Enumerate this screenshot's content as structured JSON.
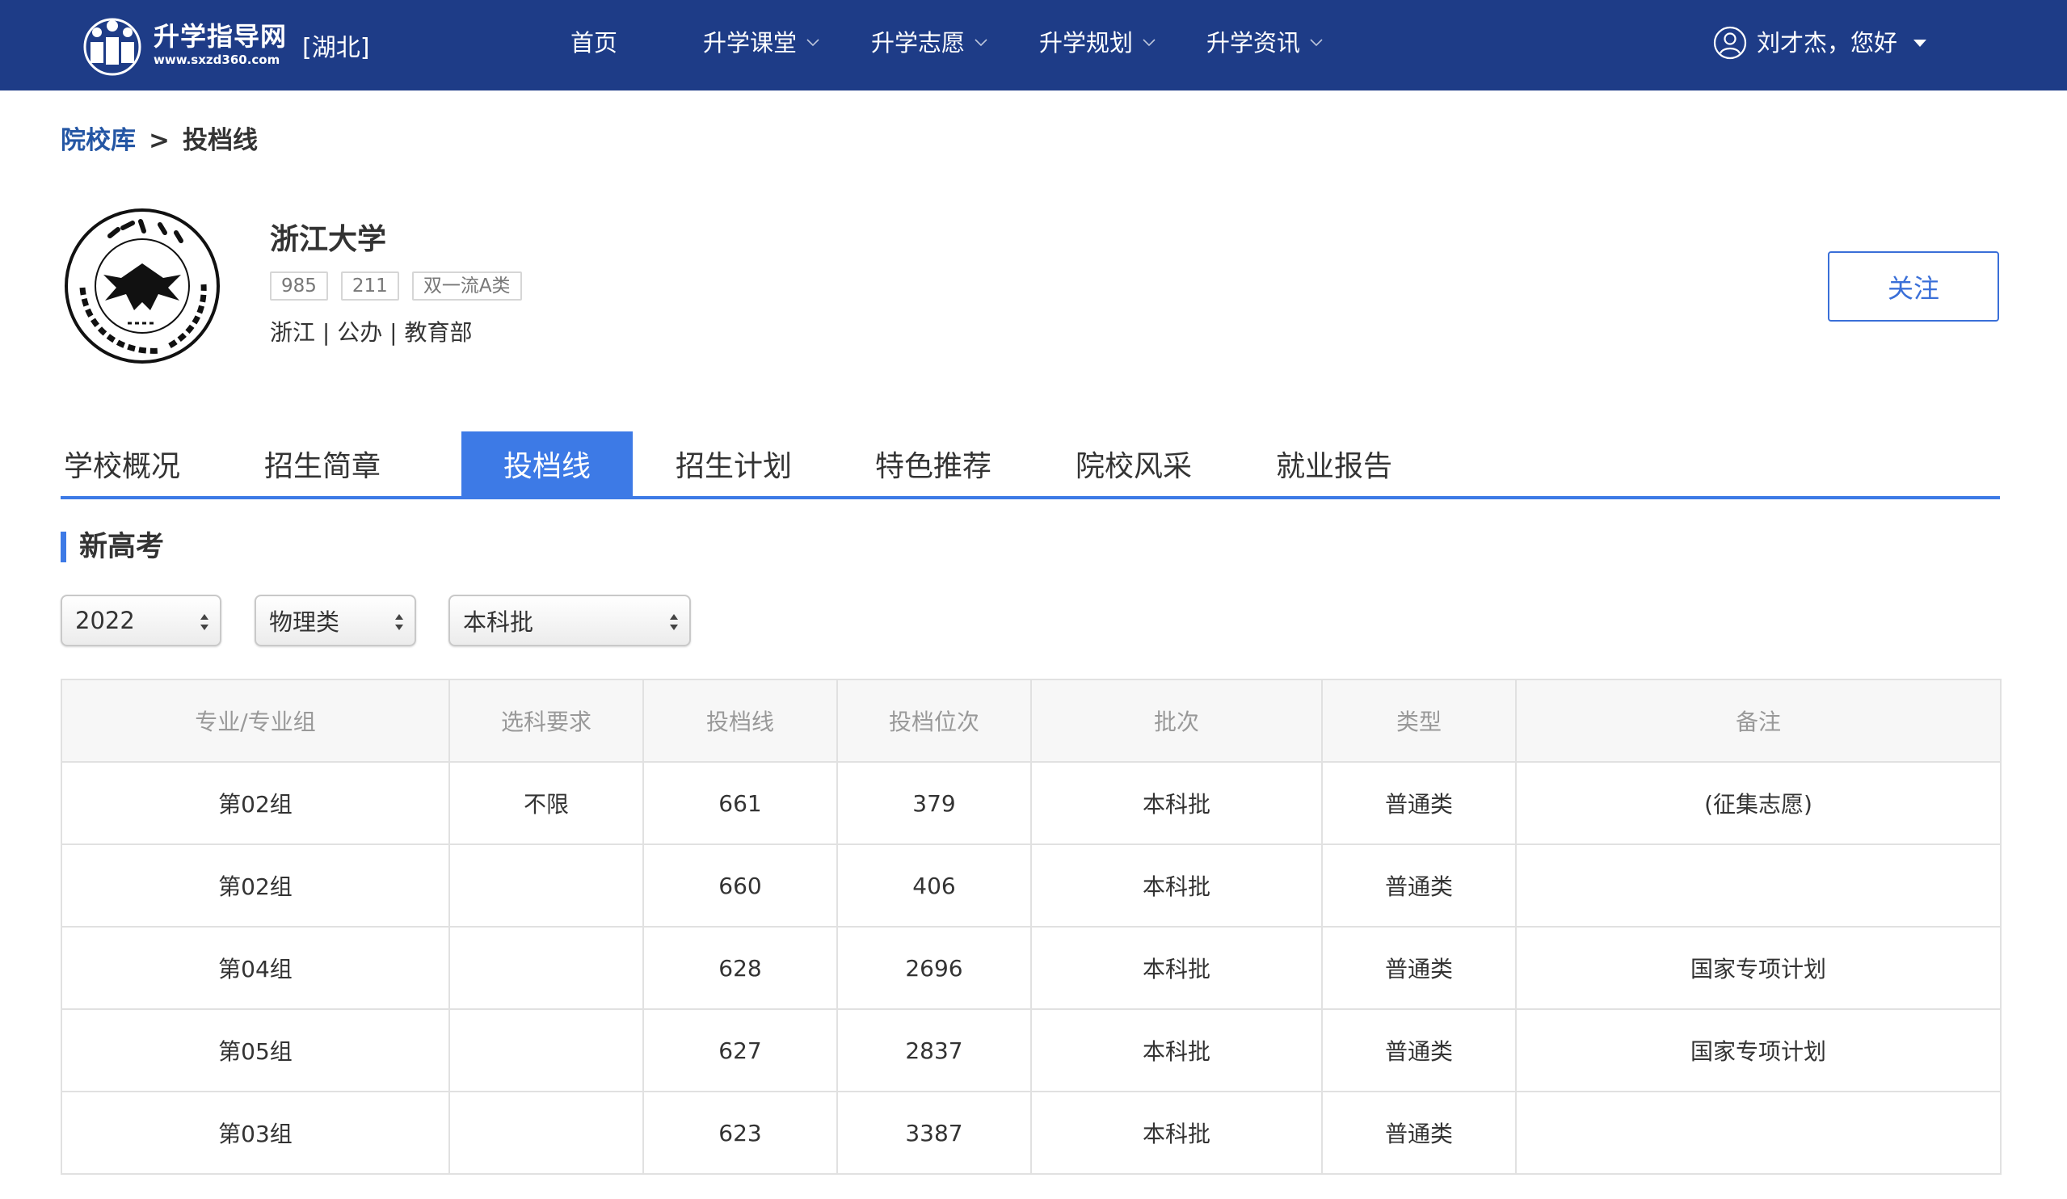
{
  "header": {
    "logo_name": "升学指导网",
    "logo_url": "www.sxzd360.com",
    "region": "[湖北]",
    "nav": [
      {
        "label": "首页",
        "has_dropdown": false
      },
      {
        "label": "升学课堂",
        "has_dropdown": true
      },
      {
        "label": "升学志愿",
        "has_dropdown": true
      },
      {
        "label": "升学规划",
        "has_dropdown": true
      },
      {
        "label": "升学资讯",
        "has_dropdown": true
      }
    ],
    "user_greeting": "刘才杰，您好"
  },
  "breadcrumb": {
    "parent": "院校库",
    "separator": ">",
    "current": "投档线"
  },
  "school": {
    "name": "浙江大学",
    "tags": [
      "985",
      "211",
      "双一流A类"
    ],
    "meta": "浙江 | 公办 | 教育部",
    "follow_label": "关注"
  },
  "tabs": [
    {
      "label": "学校概况",
      "active": false
    },
    {
      "label": "招生简章",
      "active": false
    },
    {
      "label": "投档线",
      "active": true
    },
    {
      "label": "招生计划",
      "active": false
    },
    {
      "label": "特色推荐",
      "active": false
    },
    {
      "label": "院校风采",
      "active": false
    },
    {
      "label": "就业报告",
      "active": false
    }
  ],
  "section": {
    "title": "新高考"
  },
  "filters": {
    "year": "2022",
    "subject": "物理类",
    "batch": "本科批"
  },
  "table": {
    "headers": [
      "专业/专业组",
      "选科要求",
      "投档线",
      "投档位次",
      "批次",
      "类型",
      "备注"
    ],
    "rows": [
      [
        "第02组",
        "不限",
        "661",
        "379",
        "本科批",
        "普通类",
        "(征集志愿)"
      ],
      [
        "第02组",
        "",
        "660",
        "406",
        "本科批",
        "普通类",
        ""
      ],
      [
        "第04组",
        "",
        "628",
        "2696",
        "本科批",
        "普通类",
        "国家专项计划"
      ],
      [
        "第05组",
        "",
        "627",
        "2837",
        "本科批",
        "普通类",
        "国家专项计划"
      ],
      [
        "第03组",
        "",
        "623",
        "3387",
        "本科批",
        "普通类",
        ""
      ]
    ]
  },
  "colors": {
    "header_bg": "#1e3c87",
    "accent": "#3d7ae6",
    "link": "#2456a4"
  }
}
